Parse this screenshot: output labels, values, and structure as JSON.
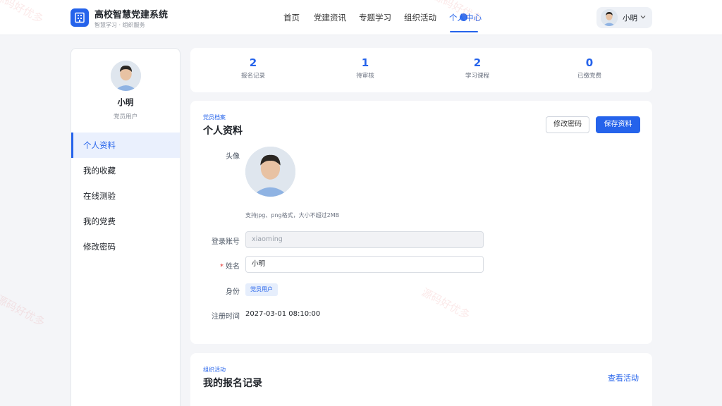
{
  "header": {
    "brand_title": "高校智慧党建系统",
    "brand_subtitle": "智慧学习 · 组织服务",
    "nav": [
      {
        "label": "首页",
        "active": false
      },
      {
        "label": "党建资讯",
        "active": false
      },
      {
        "label": "专题学习",
        "active": false
      },
      {
        "label": "组织活动",
        "active": false
      },
      {
        "label": "个人中心",
        "active": true
      }
    ],
    "user_name": "小明"
  },
  "sidebar": {
    "name": "小明",
    "role": "党员用户",
    "items": [
      {
        "label": "个人资料",
        "active": true
      },
      {
        "label": "我的收藏",
        "active": false
      },
      {
        "label": "在线测验",
        "active": false
      },
      {
        "label": "我的党费",
        "active": false
      },
      {
        "label": "修改密码",
        "active": false
      }
    ]
  },
  "stats": [
    {
      "value": "2",
      "label": "报名记录"
    },
    {
      "value": "1",
      "label": "待审核"
    },
    {
      "value": "2",
      "label": "学习课程"
    },
    {
      "value": "0",
      "label": "已缴党费"
    }
  ],
  "profile": {
    "eyebrow": "党员档案",
    "title": "个人资料",
    "change_password_label": "修改密码",
    "save_label": "保存资料",
    "avatar_label": "头像",
    "avatar_hint": "支持jpg、png格式，大小不超过2MB",
    "account_label": "登录账号",
    "account_placeholder": "xiaoming",
    "name_label": "姓名",
    "name_value": "小明",
    "identity_label": "身份",
    "identity_value": "党员用户",
    "register_label": "注册时间",
    "register_value": "2027-03-01 08:10:00"
  },
  "records": {
    "eyebrow": "组织活动",
    "title": "我的报名记录",
    "link_label": "查看活动"
  },
  "colors": {
    "accent": "#2563eb",
    "page_bg": "#f4f5f8"
  },
  "watermark": "源码好优多"
}
